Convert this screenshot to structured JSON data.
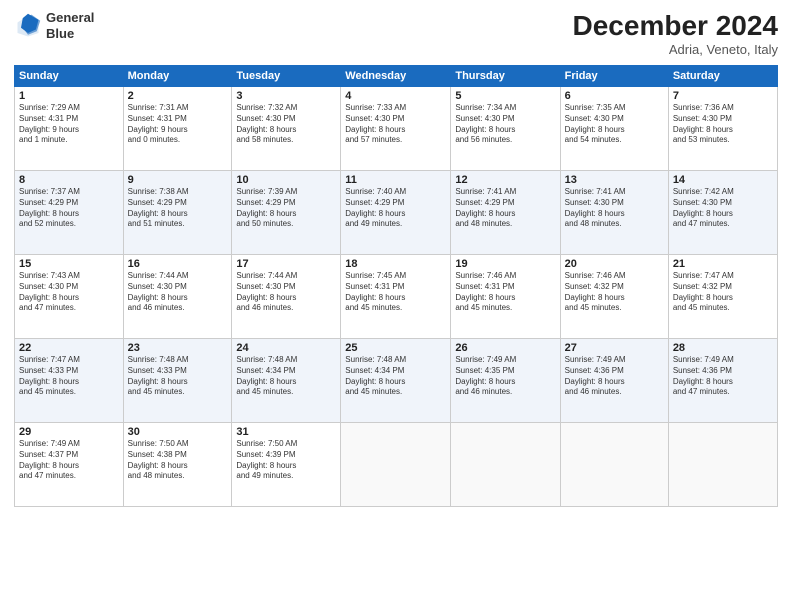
{
  "header": {
    "logo_line1": "General",
    "logo_line2": "Blue",
    "title": "December 2024",
    "subtitle": "Adria, Veneto, Italy"
  },
  "days_of_week": [
    "Sunday",
    "Monday",
    "Tuesday",
    "Wednesday",
    "Thursday",
    "Friday",
    "Saturday"
  ],
  "weeks": [
    [
      {
        "day": "1",
        "text": "Sunrise: 7:29 AM\nSunset: 4:31 PM\nDaylight: 9 hours\nand 1 minute."
      },
      {
        "day": "2",
        "text": "Sunrise: 7:31 AM\nSunset: 4:31 PM\nDaylight: 9 hours\nand 0 minutes."
      },
      {
        "day": "3",
        "text": "Sunrise: 7:32 AM\nSunset: 4:30 PM\nDaylight: 8 hours\nand 58 minutes."
      },
      {
        "day": "4",
        "text": "Sunrise: 7:33 AM\nSunset: 4:30 PM\nDaylight: 8 hours\nand 57 minutes."
      },
      {
        "day": "5",
        "text": "Sunrise: 7:34 AM\nSunset: 4:30 PM\nDaylight: 8 hours\nand 56 minutes."
      },
      {
        "day": "6",
        "text": "Sunrise: 7:35 AM\nSunset: 4:30 PM\nDaylight: 8 hours\nand 54 minutes."
      },
      {
        "day": "7",
        "text": "Sunrise: 7:36 AM\nSunset: 4:30 PM\nDaylight: 8 hours\nand 53 minutes."
      }
    ],
    [
      {
        "day": "8",
        "text": "Sunrise: 7:37 AM\nSunset: 4:29 PM\nDaylight: 8 hours\nand 52 minutes."
      },
      {
        "day": "9",
        "text": "Sunrise: 7:38 AM\nSunset: 4:29 PM\nDaylight: 8 hours\nand 51 minutes."
      },
      {
        "day": "10",
        "text": "Sunrise: 7:39 AM\nSunset: 4:29 PM\nDaylight: 8 hours\nand 50 minutes."
      },
      {
        "day": "11",
        "text": "Sunrise: 7:40 AM\nSunset: 4:29 PM\nDaylight: 8 hours\nand 49 minutes."
      },
      {
        "day": "12",
        "text": "Sunrise: 7:41 AM\nSunset: 4:29 PM\nDaylight: 8 hours\nand 48 minutes."
      },
      {
        "day": "13",
        "text": "Sunrise: 7:41 AM\nSunset: 4:30 PM\nDaylight: 8 hours\nand 48 minutes."
      },
      {
        "day": "14",
        "text": "Sunrise: 7:42 AM\nSunset: 4:30 PM\nDaylight: 8 hours\nand 47 minutes."
      }
    ],
    [
      {
        "day": "15",
        "text": "Sunrise: 7:43 AM\nSunset: 4:30 PM\nDaylight: 8 hours\nand 47 minutes."
      },
      {
        "day": "16",
        "text": "Sunrise: 7:44 AM\nSunset: 4:30 PM\nDaylight: 8 hours\nand 46 minutes."
      },
      {
        "day": "17",
        "text": "Sunrise: 7:44 AM\nSunset: 4:30 PM\nDaylight: 8 hours\nand 46 minutes."
      },
      {
        "day": "18",
        "text": "Sunrise: 7:45 AM\nSunset: 4:31 PM\nDaylight: 8 hours\nand 45 minutes."
      },
      {
        "day": "19",
        "text": "Sunrise: 7:46 AM\nSunset: 4:31 PM\nDaylight: 8 hours\nand 45 minutes."
      },
      {
        "day": "20",
        "text": "Sunrise: 7:46 AM\nSunset: 4:32 PM\nDaylight: 8 hours\nand 45 minutes."
      },
      {
        "day": "21",
        "text": "Sunrise: 7:47 AM\nSunset: 4:32 PM\nDaylight: 8 hours\nand 45 minutes."
      }
    ],
    [
      {
        "day": "22",
        "text": "Sunrise: 7:47 AM\nSunset: 4:33 PM\nDaylight: 8 hours\nand 45 minutes."
      },
      {
        "day": "23",
        "text": "Sunrise: 7:48 AM\nSunset: 4:33 PM\nDaylight: 8 hours\nand 45 minutes."
      },
      {
        "day": "24",
        "text": "Sunrise: 7:48 AM\nSunset: 4:34 PM\nDaylight: 8 hours\nand 45 minutes."
      },
      {
        "day": "25",
        "text": "Sunrise: 7:48 AM\nSunset: 4:34 PM\nDaylight: 8 hours\nand 45 minutes."
      },
      {
        "day": "26",
        "text": "Sunrise: 7:49 AM\nSunset: 4:35 PM\nDaylight: 8 hours\nand 46 minutes."
      },
      {
        "day": "27",
        "text": "Sunrise: 7:49 AM\nSunset: 4:36 PM\nDaylight: 8 hours\nand 46 minutes."
      },
      {
        "day": "28",
        "text": "Sunrise: 7:49 AM\nSunset: 4:36 PM\nDaylight: 8 hours\nand 47 minutes."
      }
    ],
    [
      {
        "day": "29",
        "text": "Sunrise: 7:49 AM\nSunset: 4:37 PM\nDaylight: 8 hours\nand 47 minutes."
      },
      {
        "day": "30",
        "text": "Sunrise: 7:50 AM\nSunset: 4:38 PM\nDaylight: 8 hours\nand 48 minutes."
      },
      {
        "day": "31",
        "text": "Sunrise: 7:50 AM\nSunset: 4:39 PM\nDaylight: 8 hours\nand 49 minutes."
      },
      {
        "day": "",
        "text": ""
      },
      {
        "day": "",
        "text": ""
      },
      {
        "day": "",
        "text": ""
      },
      {
        "day": "",
        "text": ""
      }
    ]
  ]
}
